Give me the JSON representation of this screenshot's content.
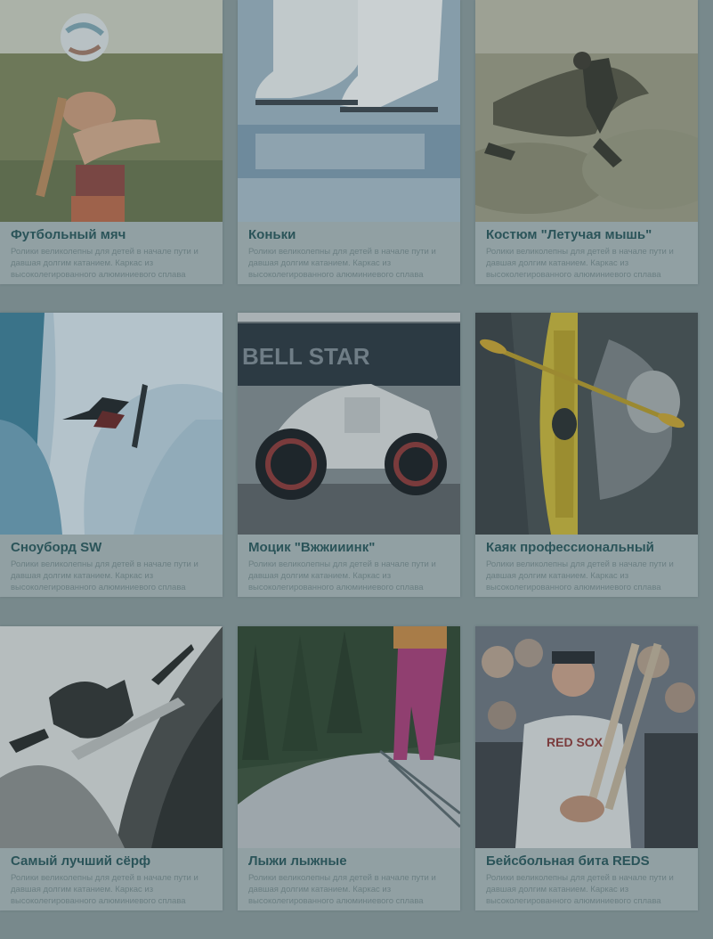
{
  "products": [
    {
      "title": "Футбольный мяч",
      "description": "Ролики великолепны для детей в начале пути и давшая долгим катанием. Каркас из высоколегированного алюминиевого сплава обеспечивает надёжность",
      "image_icon": "soccer-ball-player-icon"
    },
    {
      "title": "Коньки",
      "description": "Ролики великолепны для детей в начале пути и давшая долгим катанием. Каркас из высоколегированного алюминиевого сплава обеспечивает надёжность",
      "image_icon": "ice-skates-icon"
    },
    {
      "title": "Костюм \"Летучая мышь\"",
      "description": "Ролики великолепны для детей в начале пути и давшая долгим катанием. Каркас из высоколегированного алюминиевого сплава обеспечивает надёжность",
      "image_icon": "wingsuit-flyer-icon"
    },
    {
      "title": "Сноуборд SW",
      "description": "Ролики великолепны для детей в начале пути и давшая долгим катанием. Каркас из высоколегированного алюминиевого сплава обеспечивает надёжность",
      "image_icon": "snowboarder-icon"
    },
    {
      "title": "Моцик \"Вжжииинк\"",
      "description": "Ролики великолепны для детей в начале пути и давшая долгим катанием. Каркас из высоколегированного алюминиевого сплава обеспечивает надёжность",
      "image_icon": "motorcycle-icon"
    },
    {
      "title": "Каяк профессиональный",
      "description": "Ролики великолепны для детей в начале пути и давшая долгим катанием. Каркас из высоколегированного алюминиевого сплава обеспечивает надёжность",
      "image_icon": "kayak-icon"
    },
    {
      "title": "Самый лучший сёрф",
      "description": "Ролики великолепны для детей в начале пути и давшая долгим катанием. Каркас из высоколегированного алюминиевого сплава обеспечивает надёжность",
      "image_icon": "surfer-icon"
    },
    {
      "title": "Лыжи лыжные",
      "description": "Ролики великолепны для детей в начале пути и давшая долгим катанием. Каркас из высоколегированного алюминиевого сплава обеспечивает надёжность",
      "image_icon": "skier-icon"
    },
    {
      "title": "Бейсбольная бита REDS",
      "description": "Ролики великолепны для детей в начале пути и давшая долгим катанием. Каркас из высоколегированного алюминиевого сплава обеспечивает надёжность",
      "image_icon": "baseball-player-icon"
    }
  ],
  "colors": {
    "background": "#8a9a9d",
    "card": "#a9b6b9",
    "title": "#2c5a5f",
    "description": "#7a8e91"
  }
}
